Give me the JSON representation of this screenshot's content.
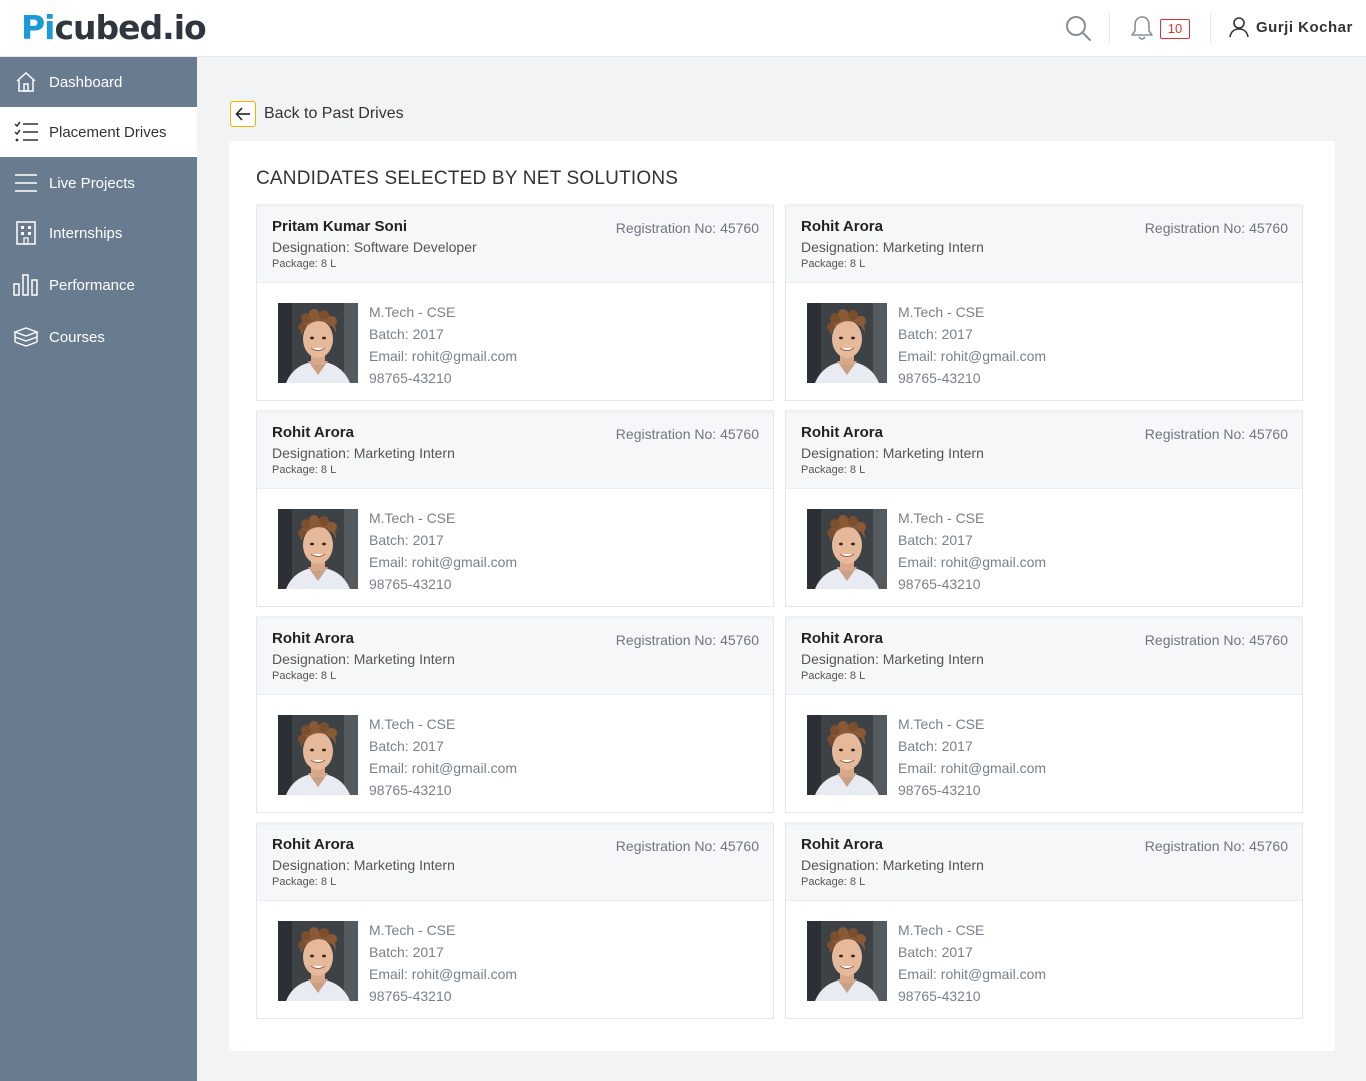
{
  "header": {
    "logo_a": "Pi",
    "logo_b": "cubed.io",
    "notification_count": "10",
    "user_name": "Gurji Kochar"
  },
  "sidebar": {
    "items": [
      {
        "label": "Dashboard",
        "icon": "home-icon",
        "active": false
      },
      {
        "label": "Placement Drives",
        "icon": "checklist-icon",
        "active": true
      },
      {
        "label": "Live Projects",
        "icon": "menu-lines-icon",
        "active": false
      },
      {
        "label": "Internships",
        "icon": "building-icon",
        "active": false
      },
      {
        "label": "Performance",
        "icon": "bar-chart-icon",
        "active": false
      },
      {
        "label": "Courses",
        "icon": "books-icon",
        "active": false
      }
    ]
  },
  "main": {
    "back_label": "Back to Past Drives",
    "title": "CANDIDATES SELECTED BY NET SOLUTIONS",
    "candidates": [
      {
        "name": "Pritam Kumar Soni",
        "registration": "Registration No: 45760",
        "designation": "Designation: Software Developer",
        "package": "Package: 8 L",
        "degree": "M.Tech - CSE",
        "batch": "Batch: 2017",
        "email": "Email: rohit@gmail.com",
        "phone": "98765-43210"
      },
      {
        "name": "Rohit Arora",
        "registration": "Registration No: 45760",
        "designation": "Designation: Marketing Intern",
        "package": "Package: 8 L",
        "degree": "M.Tech - CSE",
        "batch": "Batch: 2017",
        "email": "Email: rohit@gmail.com",
        "phone": "98765-43210"
      },
      {
        "name": "Rohit Arora",
        "registration": "Registration No: 45760",
        "designation": "Designation: Marketing Intern",
        "package": "Package: 8 L",
        "degree": "M.Tech - CSE",
        "batch": "Batch: 2017",
        "email": "Email: rohit@gmail.com",
        "phone": "98765-43210"
      },
      {
        "name": "Rohit Arora",
        "registration": "Registration No: 45760",
        "designation": "Designation: Marketing Intern",
        "package": "Package: 8 L",
        "degree": "M.Tech - CSE",
        "batch": "Batch: 2017",
        "email": "Email: rohit@gmail.com",
        "phone": "98765-43210"
      },
      {
        "name": "Rohit Arora",
        "registration": "Registration No: 45760",
        "designation": "Designation: Marketing Intern",
        "package": "Package: 8 L",
        "degree": "M.Tech - CSE",
        "batch": "Batch: 2017",
        "email": "Email: rohit@gmail.com",
        "phone": "98765-43210"
      },
      {
        "name": "Rohit Arora",
        "registration": "Registration No: 45760",
        "designation": "Designation: Marketing Intern",
        "package": "Package: 8 L",
        "degree": "M.Tech - CSE",
        "batch": "Batch: 2017",
        "email": "Email: rohit@gmail.com",
        "phone": "98765-43210"
      },
      {
        "name": "Rohit Arora",
        "registration": "Registration No: 45760",
        "designation": "Designation: Marketing Intern",
        "package": "Package: 8 L",
        "degree": "M.Tech - CSE",
        "batch": "Batch: 2017",
        "email": "Email: rohit@gmail.com",
        "phone": "98765-43210"
      },
      {
        "name": "Rohit Arora",
        "registration": "Registration No: 45760",
        "designation": "Designation: Marketing Intern",
        "package": "Package: 8 L",
        "degree": "M.Tech - CSE",
        "batch": "Batch: 2017",
        "email": "Email: rohit@gmail.com",
        "phone": "98765-43210"
      }
    ]
  },
  "colors": {
    "brand_blue": "#1a9bd7",
    "sidebar_bg": "#697b8f",
    "accent_yellow": "#f0b400",
    "badge_red": "#dd3333"
  }
}
